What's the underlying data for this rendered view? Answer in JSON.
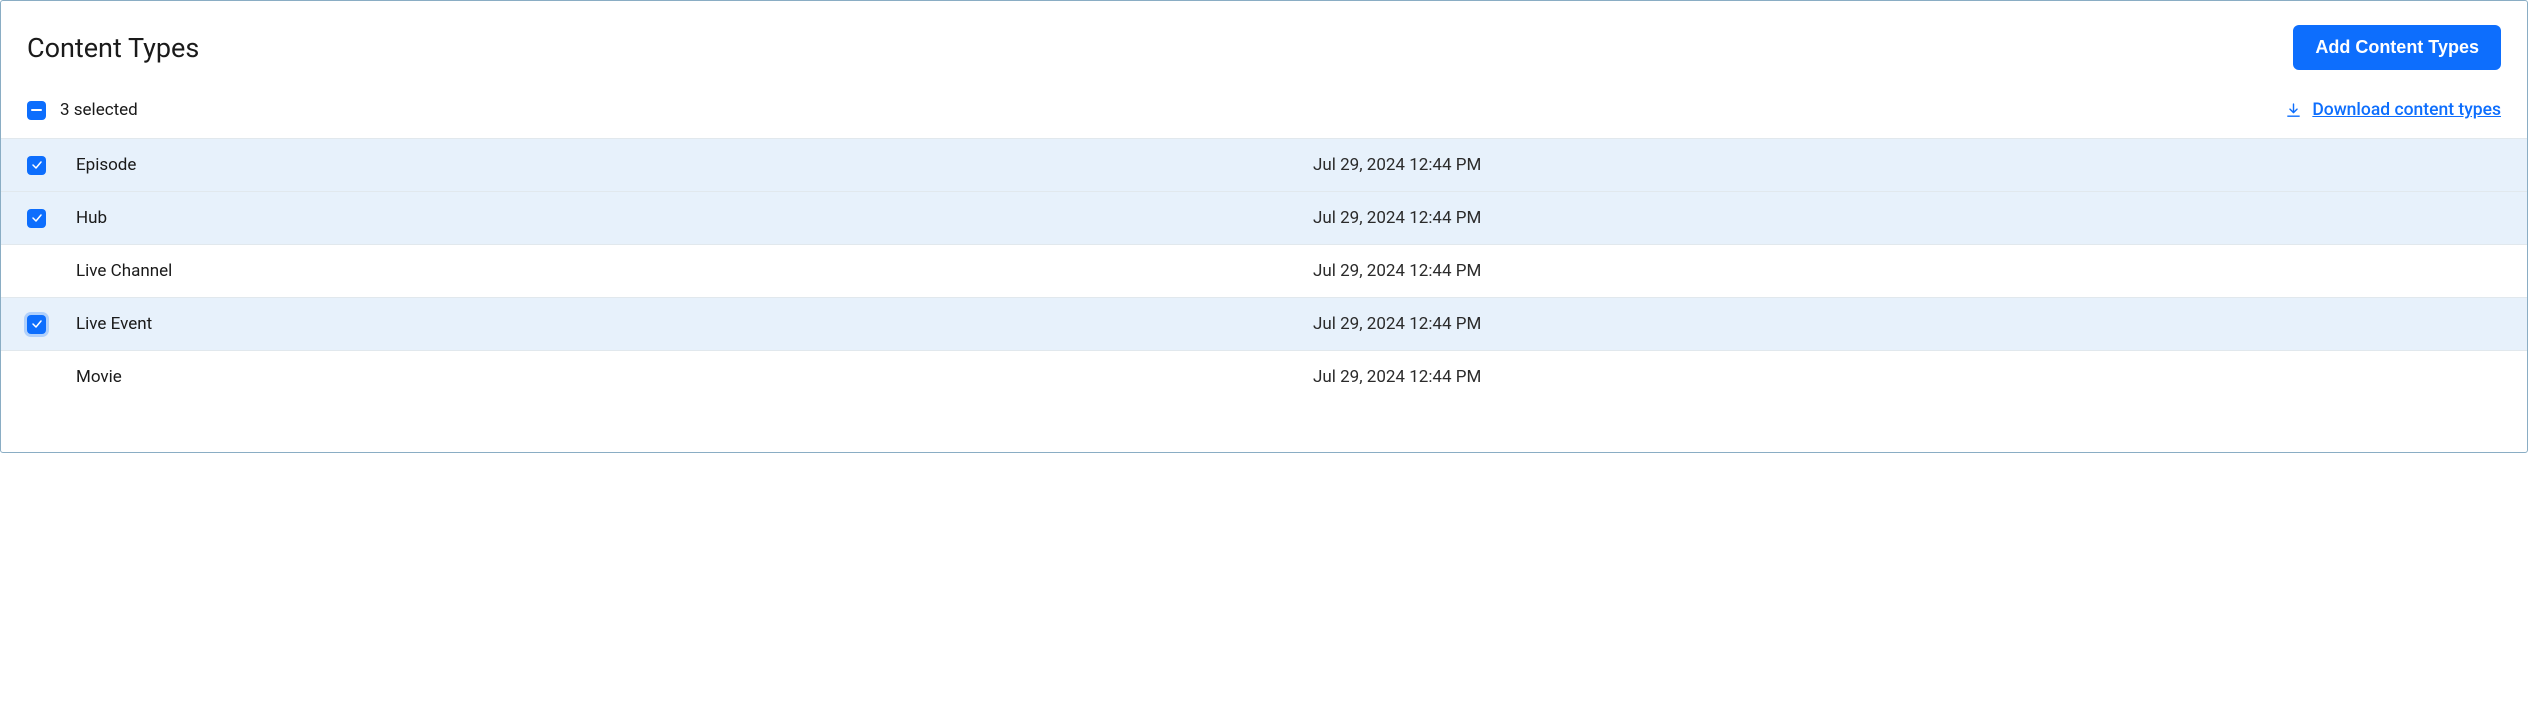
{
  "page_title": "Content Types",
  "add_button_label": "Add Content Types",
  "selected_count_text": "3 selected",
  "download_link_label": "Download content types",
  "rows": [
    {
      "name": "Episode",
      "date": "Jul 29, 2024 12:44 PM",
      "selected": true,
      "focused": false
    },
    {
      "name": "Hub",
      "date": "Jul 29, 2024 12:44 PM",
      "selected": true,
      "focused": false
    },
    {
      "name": "Live Channel",
      "date": "Jul 29, 2024 12:44 PM",
      "selected": false,
      "focused": false
    },
    {
      "name": "Live Event",
      "date": "Jul 29, 2024 12:44 PM",
      "selected": true,
      "focused": true
    },
    {
      "name": "Movie",
      "date": "Jul 29, 2024 12:44 PM",
      "selected": false,
      "focused": false
    }
  ]
}
